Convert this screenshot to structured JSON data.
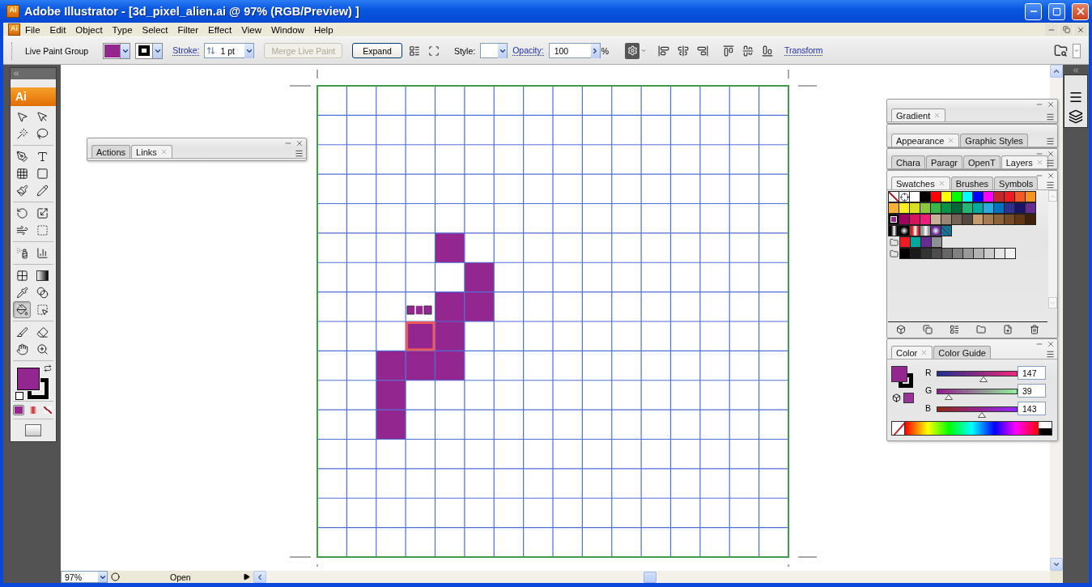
{
  "window": {
    "app_badge": "Ai",
    "title": "Adobe Illustrator - [3d_pixel_alien.ai @ 97% (RGB/Preview) ]"
  },
  "menu": {
    "app_badge": "Ai",
    "items": [
      "File",
      "Edit",
      "Object",
      "Type",
      "Select",
      "Filter",
      "Effect",
      "View",
      "Window",
      "Help"
    ]
  },
  "control_bar": {
    "selection": "Live Paint Group",
    "color_buttons": [
      {
        "kind": "fill",
        "color": "#93278f"
      },
      {
        "kind": "stroke",
        "color": "#000000"
      }
    ],
    "stroke_label": "Stroke:",
    "stroke_weight": "1 pt",
    "merge_button": {
      "label": "Merge Live Paint",
      "disabled": true
    },
    "expand_button": {
      "label": "Expand",
      "disabled": false
    },
    "style_label": "Style:",
    "opacity_label": "Opacity:",
    "opacity_value": "100",
    "opacity_unit": "%",
    "transform_link": "Transform"
  },
  "tools_panel": {
    "badge": "Ai",
    "tool_groups": [
      {
        "tools": [
          {
            "kind": "selection",
            "selected": false
          },
          {
            "kind": "direct-selection",
            "selected": false
          },
          {
            "kind": "magic-wand",
            "selected": false
          },
          {
            "kind": "lasso",
            "selected": false
          }
        ]
      },
      {
        "tools": [
          {
            "kind": "pen",
            "selected": false
          },
          {
            "kind": "type",
            "selected": false
          },
          {
            "kind": "grid",
            "selected": false
          },
          {
            "kind": "rectangle",
            "selected": false
          },
          {
            "kind": "paintbrush",
            "selected": false
          },
          {
            "kind": "pencil",
            "selected": false
          }
        ]
      },
      {
        "tools": [
          {
            "kind": "rotate",
            "selected": false
          },
          {
            "kind": "scale",
            "selected": false
          },
          {
            "kind": "warp",
            "selected": false
          },
          {
            "kind": "free-transform",
            "selected": false
          }
        ]
      },
      {
        "tools": [
          {
            "kind": "symbol-sprayer",
            "selected": false
          },
          {
            "kind": "graph",
            "selected": false
          }
        ]
      },
      {
        "tools": [
          {
            "kind": "mesh",
            "selected": false
          },
          {
            "kind": "gradient",
            "selected": false
          },
          {
            "kind": "eyedropper",
            "selected": false
          },
          {
            "kind": "blend",
            "selected": false
          },
          {
            "kind": "live-paint",
            "selected": true
          },
          {
            "kind": "live-paint-selection",
            "selected": false
          }
        ]
      },
      {
        "tools": [
          {
            "kind": "slice",
            "selected": false
          },
          {
            "kind": "eraser",
            "selected": false
          },
          {
            "kind": "hand",
            "selected": false
          },
          {
            "kind": "zoom",
            "selected": false
          }
        ]
      }
    ],
    "color_chips": [
      {
        "kind": "fill",
        "color": "#93278f"
      },
      {
        "kind": "stroke",
        "color": "#000000"
      }
    ],
    "modes": [
      {
        "kind": "color",
        "selected": true
      },
      {
        "kind": "gradient",
        "selected": false
      },
      {
        "kind": "none",
        "selected": false
      }
    ]
  },
  "links_panel": {
    "tabs": [
      {
        "label": "Actions",
        "selected": false
      },
      {
        "label": "Links",
        "selected": true
      }
    ]
  },
  "gradient_panel": {
    "tabs": [
      {
        "label": "Gradient",
        "selected": true
      }
    ]
  },
  "appearance_panel": {
    "tabs": [
      {
        "label": "Appearance",
        "selected": true
      },
      {
        "label": "Graphic Styles",
        "selected": false
      }
    ]
  },
  "layers_panel": {
    "tabs": [
      {
        "label": "Chara",
        "selected": false
      },
      {
        "label": "Paragr",
        "selected": false
      },
      {
        "label": "OpenT",
        "selected": false
      },
      {
        "label": "Layers",
        "selected": true
      }
    ]
  },
  "swatches_panel": {
    "tabs": [
      {
        "label": "Swatches",
        "selected": true
      },
      {
        "label": "Brushes",
        "selected": false
      },
      {
        "label": "Symbols",
        "selected": false
      }
    ],
    "rows": [
      {
        "kind": "colors",
        "swatches": [
          {
            "kind": "none",
            "selected": false
          },
          {
            "kind": "registration",
            "selected": false
          },
          {
            "kind": "color",
            "color": "#ffffff",
            "selected": false
          },
          {
            "kind": "color",
            "color": "#000000",
            "selected": false
          },
          {
            "kind": "color",
            "color": "#ff0000",
            "selected": false
          },
          {
            "kind": "color",
            "color": "#ffff00",
            "selected": false
          },
          {
            "kind": "color",
            "color": "#00ff00",
            "selected": false
          },
          {
            "kind": "color",
            "color": "#00ffff",
            "selected": false
          },
          {
            "kind": "color",
            "color": "#0000ff",
            "selected": false
          },
          {
            "kind": "color",
            "color": "#ff00ff",
            "selected": false
          },
          {
            "kind": "color",
            "color": "#c1272d",
            "selected": false
          },
          {
            "kind": "color",
            "color": "#ed1c24",
            "selected": false
          },
          {
            "kind": "color",
            "color": "#f15a24",
            "selected": false
          },
          {
            "kind": "color",
            "color": "#f7931e",
            "selected": false
          }
        ]
      },
      {
        "kind": "colors",
        "swatches": [
          {
            "kind": "color",
            "color": "#fbb03b",
            "selected": false
          },
          {
            "kind": "color",
            "color": "#fcee21",
            "selected": false
          },
          {
            "kind": "color",
            "color": "#d9e021",
            "selected": false
          },
          {
            "kind": "color",
            "color": "#8cc63f",
            "selected": false
          },
          {
            "kind": "color",
            "color": "#39b54a",
            "selected": false
          },
          {
            "kind": "color",
            "color": "#009245",
            "selected": false
          },
          {
            "kind": "color",
            "color": "#006837",
            "selected": false
          },
          {
            "kind": "color",
            "color": "#22b573",
            "selected": false
          },
          {
            "kind": "color",
            "color": "#00a99d",
            "selected": false
          },
          {
            "kind": "color",
            "color": "#29abe2",
            "selected": false
          },
          {
            "kind": "color",
            "color": "#0071bc",
            "selected": false
          },
          {
            "kind": "color",
            "color": "#2e3192",
            "selected": false
          },
          {
            "kind": "color",
            "color": "#1b1464",
            "selected": false
          },
          {
            "kind": "color",
            "color": "#662d91",
            "selected": false
          }
        ]
      },
      {
        "kind": "colors",
        "swatches": [
          {
            "kind": "color",
            "color": "#93278f",
            "selected": true
          },
          {
            "kind": "color",
            "color": "#9e005d",
            "selected": false
          },
          {
            "kind": "color",
            "color": "#d4145a",
            "selected": false
          },
          {
            "kind": "color",
            "color": "#ed1e79",
            "selected": false
          },
          {
            "kind": "color",
            "color": "#c7b299",
            "selected": false
          },
          {
            "kind": "color",
            "color": "#998675",
            "selected": false
          },
          {
            "kind": "color",
            "color": "#736357",
            "selected": false
          },
          {
            "kind": "color",
            "color": "#534741",
            "selected": false
          },
          {
            "kind": "color",
            "color": "#c69c6d",
            "selected": false
          },
          {
            "kind": "color",
            "color": "#a67c52",
            "selected": false
          },
          {
            "kind": "color",
            "color": "#8c6239",
            "selected": false
          },
          {
            "kind": "color",
            "color": "#754c24",
            "selected": false
          },
          {
            "kind": "color",
            "color": "#603813",
            "selected": false
          },
          {
            "kind": "color",
            "color": "#42210b",
            "selected": false
          }
        ]
      },
      {
        "kind": "colors",
        "swatches": [
          {
            "kind": "linear",
            "color": "#000000",
            "selected": false
          },
          {
            "kind": "radial",
            "color": "#000000",
            "selected": false
          },
          {
            "kind": "linear",
            "color": "#c1272d",
            "selected": false
          },
          {
            "kind": "linear",
            "color": "#999999",
            "selected": false
          },
          {
            "kind": "radial",
            "color": "#662d91",
            "selected": false
          },
          {
            "kind": "pattern",
            "color": "#0f7d8c",
            "selected": false
          }
        ]
      },
      {
        "kind": "group",
        "swatches": [
          {
            "kind": "color",
            "color": "#ed1c24",
            "selected": false
          },
          {
            "kind": "color",
            "color": "#00a99d",
            "selected": false
          },
          {
            "kind": "color",
            "color": "#662d91",
            "selected": false
          },
          {
            "kind": "color",
            "color": "#8c9196",
            "selected": false
          }
        ]
      },
      {
        "kind": "group",
        "swatches": [
          {
            "kind": "color",
            "color": "#000000",
            "selected": false
          },
          {
            "kind": "color",
            "color": "#1a1a1a",
            "selected": false
          },
          {
            "kind": "color",
            "color": "#333333",
            "selected": false
          },
          {
            "kind": "color",
            "color": "#4d4d4d",
            "selected": false
          },
          {
            "kind": "color",
            "color": "#666666",
            "selected": false
          },
          {
            "kind": "color",
            "color": "#808080",
            "selected": false
          },
          {
            "kind": "color",
            "color": "#999999",
            "selected": false
          },
          {
            "kind": "color",
            "color": "#b3b3b3",
            "selected": false
          },
          {
            "kind": "color",
            "color": "#cccccc",
            "selected": false
          },
          {
            "kind": "color",
            "color": "#e6e6e6",
            "selected": false
          },
          {
            "kind": "color",
            "color": "#f2f2f2",
            "selected": false
          }
        ]
      }
    ]
  },
  "color_panel": {
    "tabs": [
      {
        "label": "Color",
        "selected": true
      },
      {
        "label": "Color Guide",
        "selected": false
      }
    ],
    "chips": [
      {
        "kind": "fill",
        "color": "#93278f"
      },
      {
        "kind": "stroke",
        "color": "#000000"
      },
      {
        "kind": "web-safe",
        "color": "#993399"
      }
    ],
    "channels": [
      {
        "label": "R",
        "value": "147",
        "level": 0.576
      },
      {
        "label": "G",
        "value": "39",
        "level": 0.153
      },
      {
        "label": "B",
        "value": "143",
        "level": 0.561
      }
    ]
  },
  "status_bar": {
    "zoom": "97%",
    "status": "Open"
  }
}
